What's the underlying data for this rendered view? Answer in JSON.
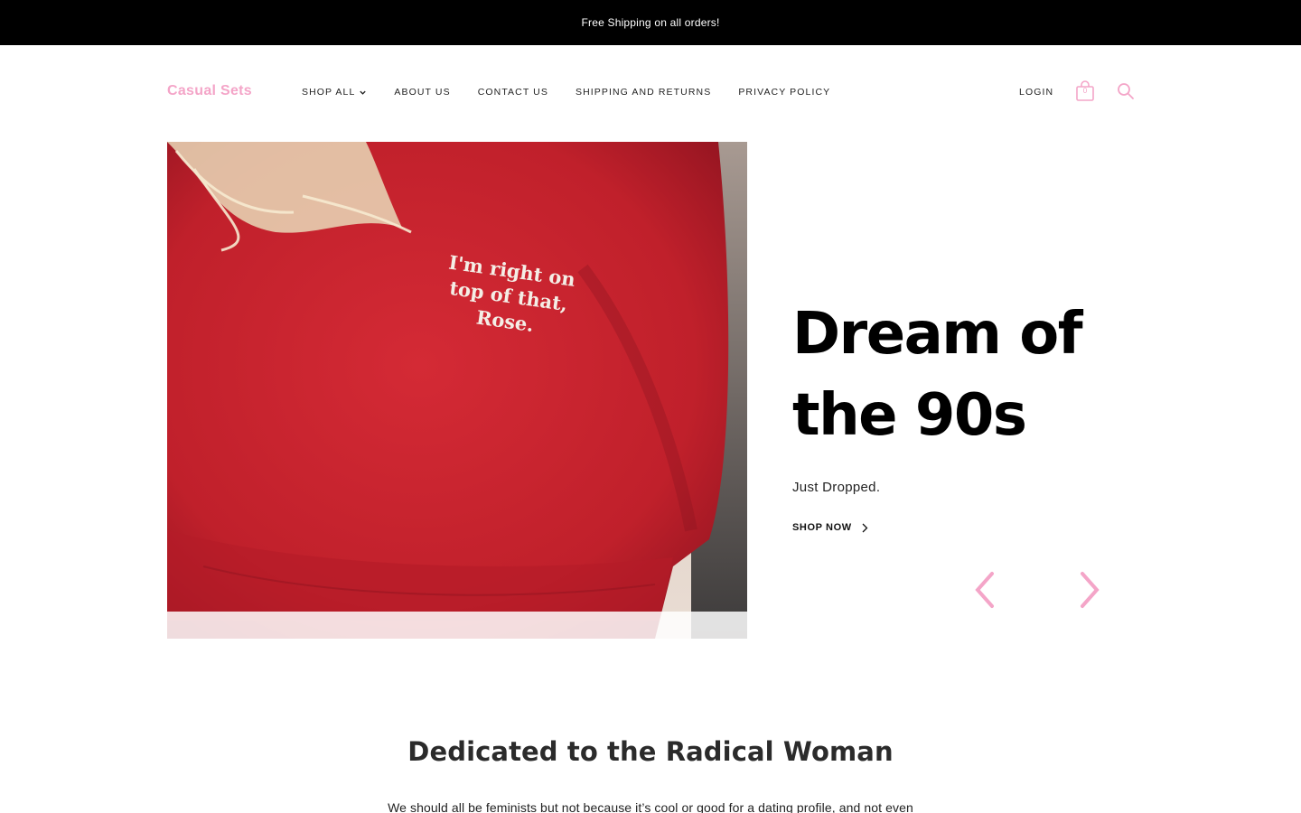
{
  "announcement": {
    "text": "Free Shipping on all orders!"
  },
  "header": {
    "logo": "Casual Sets",
    "nav": [
      {
        "label": "SHOP ALL",
        "has_dropdown": true
      },
      {
        "label": "ABOUT US"
      },
      {
        "label": "CONTACT US"
      },
      {
        "label": "SHIPPING AND RETURNS"
      },
      {
        "label": "PRIVACY POLICY"
      }
    ],
    "login_label": "LOGIN",
    "cart_count": "0",
    "icons": {
      "cart": "shopping-bag-icon",
      "search": "search-icon"
    }
  },
  "hero": {
    "image_text": [
      "I'm right on",
      "top of that,",
      "Rose."
    ],
    "title_line1": "Dream of",
    "title_line2": "the 90s",
    "subtitle": "Just Dropped.",
    "cta_label": "SHOP NOW"
  },
  "about": {
    "title": "Dedicated to the Radical Woman",
    "body": "We should all be feminists but not because it’s cool or good for a dating profile, and not even"
  },
  "colors": {
    "accent": "#f4a5c8",
    "announcement_bg": "#000000",
    "sweatshirt": "#c21f2a"
  }
}
